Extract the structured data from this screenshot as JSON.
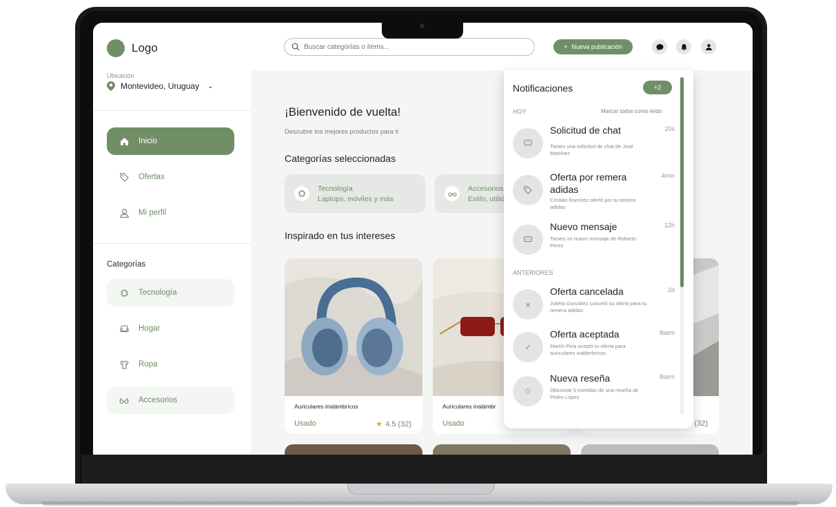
{
  "colors": {
    "brand": "#718f66",
    "brand_text": "#6c8a64",
    "panel": "#f4f6f5"
  },
  "brand": {
    "logo_text": "Logo"
  },
  "location": {
    "label": "Ubicación",
    "value": "Montevideo, Uruguay"
  },
  "nav": [
    {
      "label": "Inicio",
      "icon": "home-icon",
      "active": true
    },
    {
      "label": "Ofertas",
      "icon": "tag-icon",
      "active": false
    },
    {
      "label": "Mi perfil",
      "icon": "user-icon",
      "active": false
    }
  ],
  "categories": {
    "title": "Categorías",
    "items": [
      {
        "label": "Tecnología",
        "icon": "chip-icon"
      },
      {
        "label": "Hogar",
        "icon": "armchair-icon"
      },
      {
        "label": "Ropa",
        "icon": "shirt-icon"
      },
      {
        "label": "Accesorios",
        "icon": "glasses-icon"
      }
    ]
  },
  "search": {
    "placeholder": "Buscar categorías o items..."
  },
  "toolbar": {
    "new_post_label": "Nueva publicación",
    "icons": [
      "chat-icon",
      "bell-icon",
      "profile-icon"
    ]
  },
  "main": {
    "welcome": "¡Bienvenido de vuelta!",
    "welcome_sub": "Descubre los mejores productos para ti",
    "selected_title": "Categorías seleccionadas",
    "selected": [
      {
        "title": "Tecnología",
        "subtitle": "Laptops, móviles y más",
        "icon": "chip-icon"
      },
      {
        "title": "Accesorios",
        "subtitle": "Estilo, utilid",
        "icon": "glasses-icon"
      }
    ],
    "interests_title": "Inspirado en tus intereses",
    "products": [
      {
        "name": "Auriculares inalámbricos",
        "condition": "Usado",
        "rating": "4.5 (32)"
      },
      {
        "name": "Auriculares inalámbr",
        "condition": "Usado",
        "rating": ""
      },
      {
        "name": "",
        "condition": "",
        "rating": "5 (32)"
      }
    ]
  },
  "notifications": {
    "title": "Notificaciones",
    "badge": "+2",
    "mark_all": "Marcar todos como leído",
    "today_label": "HOY",
    "earlier_label": "ANTERIORES",
    "today": [
      {
        "title": "Solicitud de chat",
        "time": "20s",
        "desc": "Tienes una solicitud de chat de José Martínez",
        "icon": "chat-bubble-icon"
      },
      {
        "title": "Oferta por remera adidas",
        "time": "4min",
        "desc": "Cristian Ramírez ofertó por tu remera adidas",
        "icon": "tag-icon"
      },
      {
        "title": "Nuevo mensaje",
        "time": "12h",
        "desc": "Tienes un nuevo mensaje de Roberto Pérez",
        "icon": "chat-bubble-icon"
      }
    ],
    "earlier": [
      {
        "title": "Oferta cancelada",
        "time": "2d",
        "desc": "Julieta González canceló su oferta para tu remera adidas",
        "icon": "close-icon"
      },
      {
        "title": "Oferta aceptada",
        "time": "8sem",
        "desc": "Martín Piria aceptó tu oferta para auriculares inalámbricos",
        "icon": "check-icon"
      },
      {
        "title": "Nueva reseña",
        "time": "8sem",
        "desc": "Obtuviste 5 estrellas de una reseña de Pedro López",
        "icon": "star-icon"
      }
    ]
  }
}
